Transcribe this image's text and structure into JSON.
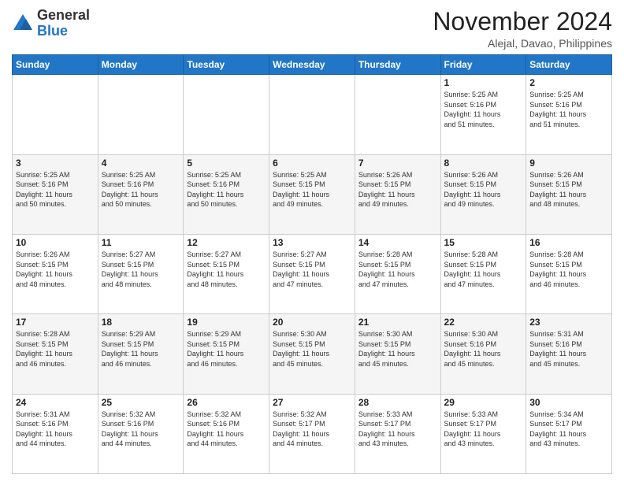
{
  "logo": {
    "general": "General",
    "blue": "Blue"
  },
  "header": {
    "month_year": "November 2024",
    "location": "Alejal, Davao, Philippines"
  },
  "days_of_week": [
    "Sunday",
    "Monday",
    "Tuesday",
    "Wednesday",
    "Thursday",
    "Friday",
    "Saturday"
  ],
  "weeks": [
    [
      {
        "day": "",
        "info": ""
      },
      {
        "day": "",
        "info": ""
      },
      {
        "day": "",
        "info": ""
      },
      {
        "day": "",
        "info": ""
      },
      {
        "day": "",
        "info": ""
      },
      {
        "day": "1",
        "info": "Sunrise: 5:25 AM\nSunset: 5:16 PM\nDaylight: 11 hours\nand 51 minutes."
      },
      {
        "day": "2",
        "info": "Sunrise: 5:25 AM\nSunset: 5:16 PM\nDaylight: 11 hours\nand 51 minutes."
      }
    ],
    [
      {
        "day": "3",
        "info": "Sunrise: 5:25 AM\nSunset: 5:16 PM\nDaylight: 11 hours\nand 50 minutes."
      },
      {
        "day": "4",
        "info": "Sunrise: 5:25 AM\nSunset: 5:16 PM\nDaylight: 11 hours\nand 50 minutes."
      },
      {
        "day": "5",
        "info": "Sunrise: 5:25 AM\nSunset: 5:16 PM\nDaylight: 11 hours\nand 50 minutes."
      },
      {
        "day": "6",
        "info": "Sunrise: 5:25 AM\nSunset: 5:15 PM\nDaylight: 11 hours\nand 49 minutes."
      },
      {
        "day": "7",
        "info": "Sunrise: 5:26 AM\nSunset: 5:15 PM\nDaylight: 11 hours\nand 49 minutes."
      },
      {
        "day": "8",
        "info": "Sunrise: 5:26 AM\nSunset: 5:15 PM\nDaylight: 11 hours\nand 49 minutes."
      },
      {
        "day": "9",
        "info": "Sunrise: 5:26 AM\nSunset: 5:15 PM\nDaylight: 11 hours\nand 48 minutes."
      }
    ],
    [
      {
        "day": "10",
        "info": "Sunrise: 5:26 AM\nSunset: 5:15 PM\nDaylight: 11 hours\nand 48 minutes."
      },
      {
        "day": "11",
        "info": "Sunrise: 5:27 AM\nSunset: 5:15 PM\nDaylight: 11 hours\nand 48 minutes."
      },
      {
        "day": "12",
        "info": "Sunrise: 5:27 AM\nSunset: 5:15 PM\nDaylight: 11 hours\nand 48 minutes."
      },
      {
        "day": "13",
        "info": "Sunrise: 5:27 AM\nSunset: 5:15 PM\nDaylight: 11 hours\nand 47 minutes."
      },
      {
        "day": "14",
        "info": "Sunrise: 5:28 AM\nSunset: 5:15 PM\nDaylight: 11 hours\nand 47 minutes."
      },
      {
        "day": "15",
        "info": "Sunrise: 5:28 AM\nSunset: 5:15 PM\nDaylight: 11 hours\nand 47 minutes."
      },
      {
        "day": "16",
        "info": "Sunrise: 5:28 AM\nSunset: 5:15 PM\nDaylight: 11 hours\nand 46 minutes."
      }
    ],
    [
      {
        "day": "17",
        "info": "Sunrise: 5:28 AM\nSunset: 5:15 PM\nDaylight: 11 hours\nand 46 minutes."
      },
      {
        "day": "18",
        "info": "Sunrise: 5:29 AM\nSunset: 5:15 PM\nDaylight: 11 hours\nand 46 minutes."
      },
      {
        "day": "19",
        "info": "Sunrise: 5:29 AM\nSunset: 5:15 PM\nDaylight: 11 hours\nand 46 minutes."
      },
      {
        "day": "20",
        "info": "Sunrise: 5:30 AM\nSunset: 5:15 PM\nDaylight: 11 hours\nand 45 minutes."
      },
      {
        "day": "21",
        "info": "Sunrise: 5:30 AM\nSunset: 5:15 PM\nDaylight: 11 hours\nand 45 minutes."
      },
      {
        "day": "22",
        "info": "Sunrise: 5:30 AM\nSunset: 5:16 PM\nDaylight: 11 hours\nand 45 minutes."
      },
      {
        "day": "23",
        "info": "Sunrise: 5:31 AM\nSunset: 5:16 PM\nDaylight: 11 hours\nand 45 minutes."
      }
    ],
    [
      {
        "day": "24",
        "info": "Sunrise: 5:31 AM\nSunset: 5:16 PM\nDaylight: 11 hours\nand 44 minutes."
      },
      {
        "day": "25",
        "info": "Sunrise: 5:32 AM\nSunset: 5:16 PM\nDaylight: 11 hours\nand 44 minutes."
      },
      {
        "day": "26",
        "info": "Sunrise: 5:32 AM\nSunset: 5:16 PM\nDaylight: 11 hours\nand 44 minutes."
      },
      {
        "day": "27",
        "info": "Sunrise: 5:32 AM\nSunset: 5:17 PM\nDaylight: 11 hours\nand 44 minutes."
      },
      {
        "day": "28",
        "info": "Sunrise: 5:33 AM\nSunset: 5:17 PM\nDaylight: 11 hours\nand 43 minutes."
      },
      {
        "day": "29",
        "info": "Sunrise: 5:33 AM\nSunset: 5:17 PM\nDaylight: 11 hours\nand 43 minutes."
      },
      {
        "day": "30",
        "info": "Sunrise: 5:34 AM\nSunset: 5:17 PM\nDaylight: 11 hours\nand 43 minutes."
      }
    ]
  ]
}
